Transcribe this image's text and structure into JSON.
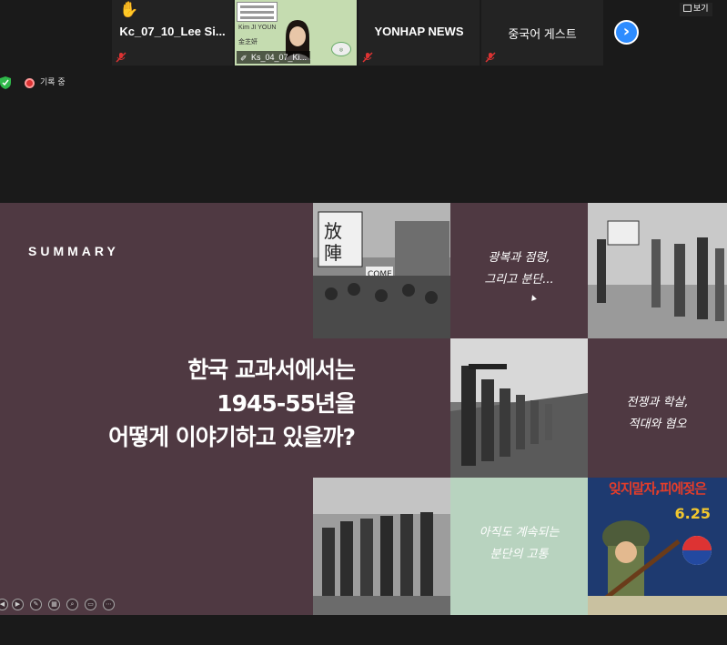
{
  "participants": [
    {
      "name": "Kc_07_10_Lee  Si...",
      "raised_hand": true,
      "muted": true
    },
    {
      "name": "YONHAP NEWS",
      "muted": true
    },
    {
      "name": "중국어 게스트",
      "muted": true
    }
  ],
  "video_tile": {
    "label": "Ks_04_07_Ki...",
    "line1": "Kim JI YOUN",
    "line2": "金芝妍"
  },
  "view_button": {
    "label": "보기"
  },
  "next_icon": "chevron-right-icon",
  "status": {
    "recording_label": "기록 중"
  },
  "slide": {
    "summary": "SUMMARY",
    "headline_lines": [
      "한국 교과서에서는",
      "1945-55년을",
      "어떻게 이야기하고 있을까?"
    ],
    "captions": [
      [
        "광복과 점령,",
        "그리고 분단..."
      ],
      [
        "전쟁과 학살,",
        "적대와 혐오"
      ],
      [
        "아직도 계속되는",
        "분단의 고통"
      ]
    ],
    "poster": {
      "title": "잊지말자,피에젖은",
      "number": "6.25"
    }
  },
  "colors": {
    "slide_bg": "#4f3942",
    "mint": "#b8d3bf",
    "zoom_blue": "#2d8cff",
    "recording_red": "#dd3333",
    "video_bg": "#c5dcb0"
  }
}
